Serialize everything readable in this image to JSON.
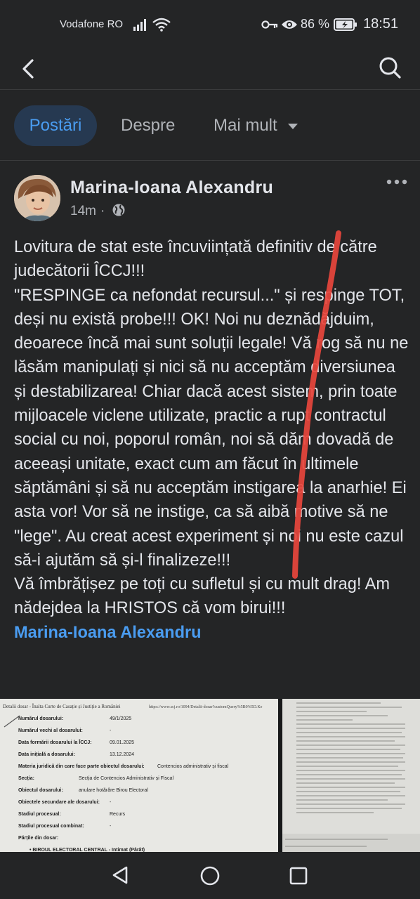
{
  "status_bar": {
    "carrier": "Vodafone RO",
    "battery": "86 %",
    "time": "18:51"
  },
  "header": {
    "back_icon": "chevron-left-icon",
    "search_icon": "search-icon"
  },
  "tabs": [
    {
      "label": "Postări",
      "active": true
    },
    {
      "label": "Despre",
      "active": false
    },
    {
      "label": "Mai mult",
      "active": false
    }
  ],
  "post": {
    "author": "Marina-Ioana Alexandru",
    "time": "14m",
    "visibility_icon": "globe-icon",
    "paragraphs": [
      "Lovitura de stat este încuviințată definitiv de către judecătorii ÎCCJ!!!",
      "\"RESPINGE ca nefondat recursul...\" și respinge TOT, deși nu există probe!!! OK! Noi nu deznădăjduim, deoarece încă mai sunt soluții legale! Vă rog să nu ne lăsăm manipulați și nici să nu acceptăm diversiunea și destabilizarea! Chiar dacă acest sistem, prin toate mijloacele viclene utilizate, practic a rupt contractul social cu noi, poporul român, noi să dăm dovadă de aceeași unitate, exact cum am făcut în ultimele săptămâni și să nu acceptăm instigarea la anarhie! Ei asta vor! Vor să ne instige, ca să aibă motive să ne \"lege\". Au creat acest experiment și noi nu este cazul să-i ajutăm să și-l finalizeze!!!",
      "Vă îmbrățișez pe toți cu sufletul și cu mult drag! Am nădejdea la HRISTOS că vom birui!!!"
    ],
    "signature": "Marina-Ioana Alexandru"
  },
  "document_photo": {
    "heading": "Detalii dosar - Înalta Curte de Casație și Justiție a României",
    "url": "https://www.scj.ro/1094/Detalii-dosar?customQuery%5B0%5D.Ke",
    "rows": [
      {
        "label": "Numărul dosarului:",
        "value": "49/1/2025"
      },
      {
        "label": "Numărul vechi al dosarului:",
        "value": "-"
      },
      {
        "label": "Data formării dosarului la ÎCCJ:",
        "value": "09.01.2025"
      },
      {
        "label": "Data inițială a dosarului:",
        "value": "13.12.2024"
      },
      {
        "label": "Materia juridică din care face parte obiectul dosarului:",
        "value": "Contencios administrativ și fiscal"
      },
      {
        "label": "Secția:",
        "value": "Secția de Contencios Administrativ și Fiscal"
      },
      {
        "label": "Obiectul dosarului:",
        "value": "anulare hotărâre Birou Electoral"
      },
      {
        "label": "Obiectele secundare ale dosarului:",
        "value": "-"
      },
      {
        "label": "Stadiul procesual:",
        "value": "Recurs"
      },
      {
        "label": "Stadiul procesual combinat:",
        "value": "-"
      },
      {
        "label": "Părțile din dosar:",
        "value": ""
      },
      {
        "label": "• BIROUL ELECTORAL CENTRAL - Intimat (Pârât)",
        "value": ""
      }
    ]
  },
  "colors": {
    "background": "#242526",
    "text": "#e4e6eb",
    "muted": "#b0b3b8",
    "accent": "#4a9cf0",
    "tab_active_bg": "#263951",
    "annotation_stroke": "#e8453c"
  },
  "navbar": {
    "back_icon": "nav-back-icon",
    "home_icon": "nav-home-icon",
    "recent_icon": "nav-recent-icon"
  }
}
